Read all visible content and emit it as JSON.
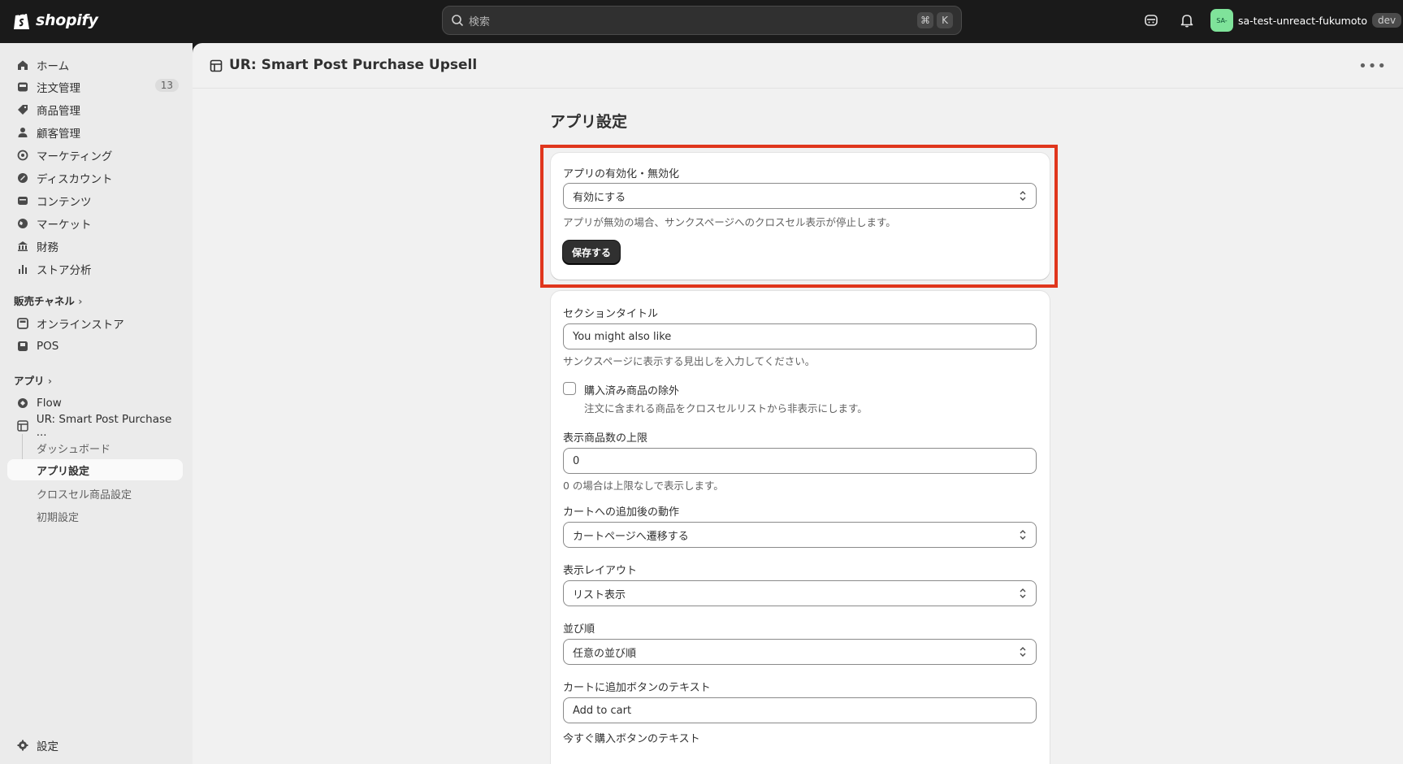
{
  "topbar": {
    "logo_text": "shopify",
    "search_placeholder": "検索",
    "shortcut_keys": [
      "⌘",
      "K"
    ],
    "store_avatar": "SA-",
    "store_name": "sa-test-unreact-fukumoto",
    "store_badge": "dev"
  },
  "sidebar": {
    "items": [
      {
        "label": "ホーム",
        "icon": "home-icon"
      },
      {
        "label": "注文管理",
        "icon": "inbox-icon",
        "badge": "13"
      },
      {
        "label": "商品管理",
        "icon": "tag-icon"
      },
      {
        "label": "顧客管理",
        "icon": "person-icon"
      },
      {
        "label": "マーケティング",
        "icon": "target-icon"
      },
      {
        "label": "ディスカウント",
        "icon": "discount-icon"
      },
      {
        "label": "コンテンツ",
        "icon": "content-icon"
      },
      {
        "label": "マーケット",
        "icon": "globe-icon"
      },
      {
        "label": "財務",
        "icon": "bank-icon"
      },
      {
        "label": "ストア分析",
        "icon": "chart-icon"
      }
    ],
    "sales_channels_label": "販売チャネル",
    "channels": [
      {
        "label": "オンラインストア",
        "icon": "store-icon"
      },
      {
        "label": "POS",
        "icon": "pos-icon"
      }
    ],
    "apps_label": "アプリ",
    "apps": [
      {
        "label": "Flow",
        "icon": "flow-icon"
      },
      {
        "label": "UR: Smart Post Purchase ...",
        "icon": "app-icon"
      }
    ],
    "app_sub_items": [
      "ダッシュボード",
      "アプリ設定",
      "クロスセル商品設定",
      "初期設定"
    ],
    "settings_label": "設定"
  },
  "page": {
    "title": "UR: Smart Post Purchase Upsell",
    "section_heading": "アプリ設定"
  },
  "card1": {
    "label": "アプリの有効化・無効化",
    "select_value": "有効にする",
    "help": "アプリが無効の場合、サンクスページへのクロスセル表示が停止します。",
    "save_label": "保存する"
  },
  "card2": {
    "section_title_label": "セクションタイトル",
    "section_title_value": "You might also like",
    "section_title_help": "サンクスページに表示する見出しを入力してください。",
    "exclude_label": "購入済み商品の除外",
    "exclude_help": "注文に含まれる商品をクロスセルリストから非表示にします。",
    "exclude_checked": false,
    "max_label": "表示商品数の上限",
    "max_value": "0",
    "max_help": "0 の場合は上限なしで表示します。",
    "after_add_label": "カートへの追加後の動作",
    "after_add_value": "カートページへ遷移する",
    "layout_label": "表示レイアウト",
    "layout_value": "リスト表示",
    "sort_label": "並び順",
    "sort_value": "任意の並び順",
    "add_btn_label": "カートに追加ボタンのテキスト",
    "add_btn_value": "Add to cart",
    "buy_now_label": "今すぐ購入ボタンのテキスト"
  }
}
